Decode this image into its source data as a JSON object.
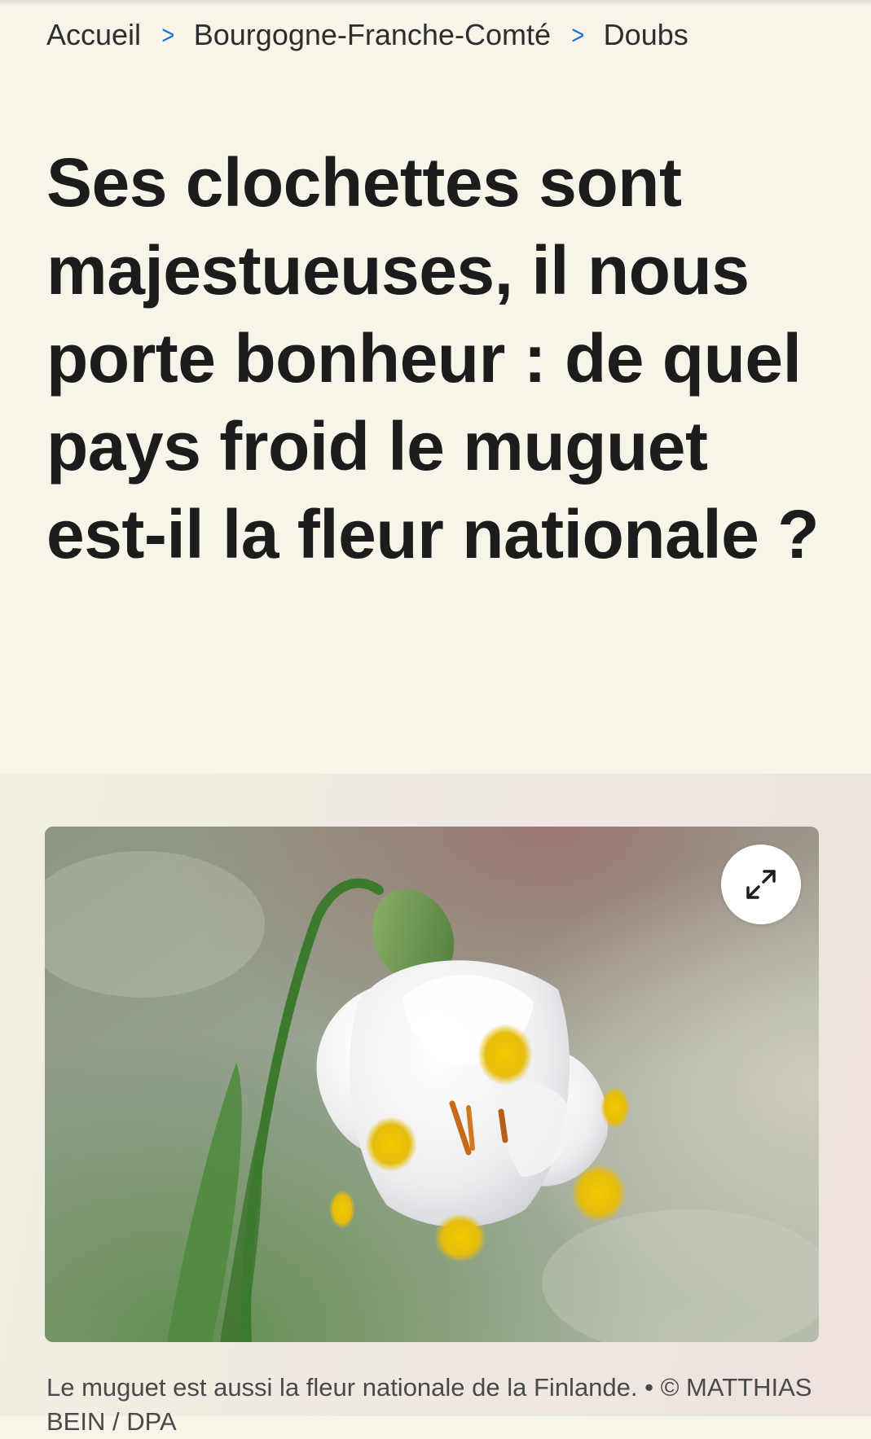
{
  "breadcrumb": {
    "items": [
      "Accueil",
      "Bourgogne-Franche-Comté",
      "Doubs"
    ],
    "separator": ">"
  },
  "article": {
    "headline": "Ses clochettes sont majestueuses, il nous porte bonheur : de quel pays froid le muguet est-il la fleur nationale ?"
  },
  "image": {
    "icon": "expand-icon",
    "caption": "Le muguet est aussi la fleur nationale de la Finlande. • © MATTHIAS BEIN / DPA"
  },
  "colors": {
    "page_background": "#f7f4ea",
    "separator_accent": "#1a73d9",
    "headline_text": "#1c1c1c"
  }
}
